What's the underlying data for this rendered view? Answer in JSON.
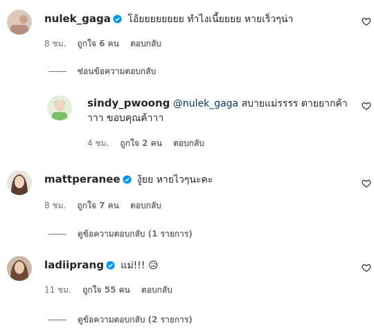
{
  "comments": [
    {
      "username": "nulek_gaga",
      "verified": true,
      "text": "โอ้ยยยยยยยย ทำไงเนี้ยยยย หายเร็วๆน่า",
      "time": "8 ชม.",
      "likes": "ถูกใจ 6 คน",
      "reply_label": "ตอบกลับ",
      "toggle_label": "ซ่อนข้อความตอบกลับ",
      "replies": [
        {
          "username": "sindy_pwoong",
          "mention": "@nulek_gaga",
          "text_line1": "สบายแม่รรรร ตายยากค้า",
          "text_line2": "าาา ขอบคุณค้าาา",
          "time": "4 ชม.",
          "likes": "ถูกใจ 2 คน",
          "reply_label": "ตอบกลับ"
        }
      ]
    },
    {
      "username": "mattperanee",
      "verified": true,
      "text": "งู้ยย หายไวๆนะคะ",
      "time": "8 ชม.",
      "likes": "ถูกใจ 7 คน",
      "reply_label": "ตอบกลับ",
      "toggle_label": "ดูข้อความตอบกลับ (1 รายการ)"
    },
    {
      "username": "ladiiprang",
      "verified": true,
      "text": "แม่!!! 😥",
      "time": "11 ชม.",
      "likes": "ถูกใจ 55 คน",
      "reply_label": "ตอบกลับ",
      "toggle_label": "ดูข้อความตอบกลับ (2 รายการ)"
    }
  ],
  "colors": {
    "text": "#262626",
    "secondary": "#737373",
    "mention": "#00376b",
    "verified": "#0095f6"
  },
  "icons": {
    "like": "heart-outline-icon",
    "verified": "verified-badge-icon"
  }
}
